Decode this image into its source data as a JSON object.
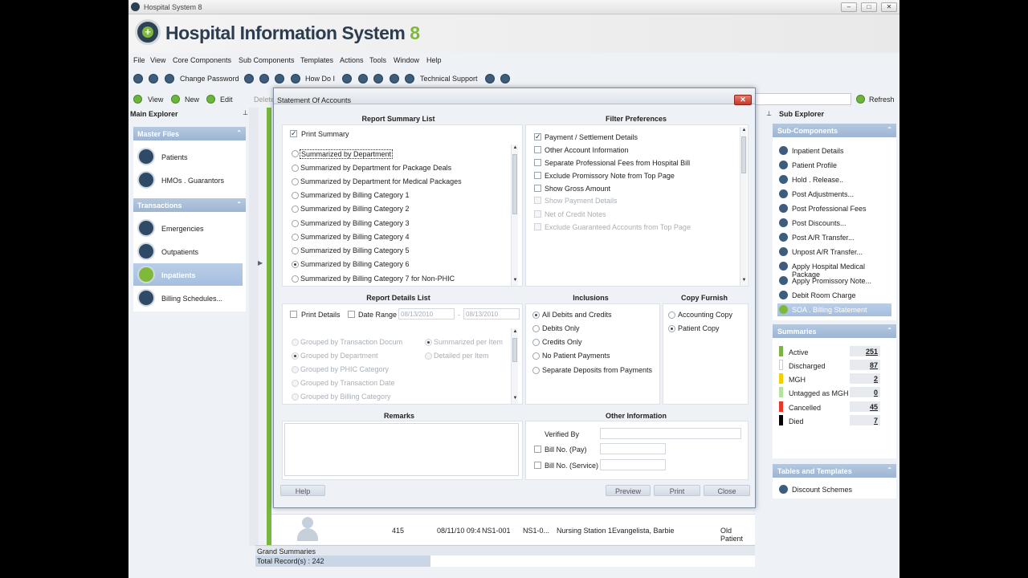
{
  "window": {
    "title": "Hospital System 8",
    "min": "–",
    "max": "□",
    "close": "✕"
  },
  "banner": {
    "title": "Hospital Information System",
    "version": "8"
  },
  "menu": [
    "File",
    "View",
    "Core Components",
    "Sub Components",
    "Templates",
    "Actions",
    "Tools",
    "Window",
    "Help"
  ],
  "toolbar1": {
    "change_password": "Change Password",
    "how_do_i": "How Do I",
    "technical_support": "Technical Support"
  },
  "toolbar2": {
    "view": "View",
    "new": "New",
    "edit": "Edit",
    "delete": "Delete",
    "refresh": "Refresh"
  },
  "left": {
    "header": "Main Explorer",
    "master_files": {
      "title": "Master Files",
      "items": [
        "Patients",
        "HMOs . Guarantors"
      ]
    },
    "transactions": {
      "title": "Transactions",
      "items": [
        "Emergencies",
        "Outpatients",
        "Inpatients",
        "Billing Schedules..."
      ]
    }
  },
  "grid_row": {
    "num": "415",
    "date": "08/11/10 09:4",
    "room": "NS1-001",
    "bed": "NS1-0...",
    "station": "Nursing Station 1",
    "name": "Evangelista, Barbie",
    "type": "Old Patient"
  },
  "bottom": {
    "grand": "Grand Summaries",
    "total": "Total Record(s) : 242"
  },
  "right": {
    "header": "Sub Explorer",
    "subcomponents": {
      "title": "Sub-Components",
      "items": [
        "Inpatient Details",
        "Patient Profile",
        "Hold . Release..",
        "Post Adjustments...",
        "Post Professional Fees",
        "Post Discounts...",
        "Post A/R Transfer...",
        "Unpost A/R Transfer...",
        "Apply Hospital Medical Package",
        "Apply Promissory Note...",
        "Debit Room Charge",
        "SOA . Billing Statement"
      ]
    },
    "summaries": {
      "title": "Summaries",
      "rows": [
        {
          "label": "Active",
          "value": "251",
          "color": "#7db244"
        },
        {
          "label": "Discharged",
          "value": "87",
          "color": "#ffffff"
        },
        {
          "label": "MGH",
          "value": "2",
          "color": "#f0d000"
        },
        {
          "label": "Untagged as MGH",
          "value": "0",
          "color": "#b8e0a0"
        },
        {
          "label": "Cancelled",
          "value": "45",
          "color": "#e8372a"
        },
        {
          "label": "Died",
          "value": "7",
          "color": "#000000"
        }
      ]
    },
    "tables": {
      "title": "Tables and Templates",
      "items": [
        "Discount Schemes"
      ]
    }
  },
  "dialog": {
    "title": "Statement Of Accounts",
    "close": "✕",
    "report_summary": {
      "title": "Report Summary List",
      "print_summary": "Print Summary",
      "options": [
        "Summarized by Department",
        "Summarized by Department for Package Deals",
        "Summarized by Department for Medical Packages",
        "Summarized by Billing Category 1",
        "Summarized by Billing Category 2",
        "Summarized by Billing Category 3",
        "Summarized by Billing Category 4",
        "Summarized by Billing Category 5",
        "Summarized by Billing Category 6",
        "Summarized by Billing Category 7 for Non-PHIC"
      ]
    },
    "filter": {
      "title": "Filter Preferences",
      "options": [
        "Payment / Settlement Details",
        "Other Account Information",
        "Separate Professional Fees from Hospital Bill",
        "Exclude Promissory Note from Top Page",
        "Show Gross Amount",
        "Show Payment Details",
        "Net of Credit Notes",
        "Exclude Guaranteed Accounts from Top Page"
      ]
    },
    "details": {
      "title": "Report Details List",
      "print_details": "Print Details",
      "date_range": "Date Range",
      "date_from": "08/13/2010",
      "date_sep": "-",
      "date_to": "08/13/2010",
      "group_options": [
        "Grouped by Transaction Docum",
        "Grouped by Department",
        "Grouped by PHIC Category",
        "Grouped by Transaction Date",
        "Grouped by Billing Category"
      ],
      "item_options": [
        "Summarized per Item",
        "Detailed per Item"
      ]
    },
    "inclusions": {
      "title": "Inclusions",
      "options": [
        "All Debits and Credits",
        "Debits Only",
        "Credits Only",
        "No Patient Payments",
        "Separate Deposits from Payments"
      ]
    },
    "copy": {
      "title": "Copy Furnish",
      "options": [
        "Accounting Copy",
        "Patient Copy"
      ]
    },
    "remarks": {
      "title": "Remarks"
    },
    "other": {
      "title": "Other Information",
      "verified_by": "Verified By",
      "bill_pay": "Bill No. (Pay)",
      "bill_service": "Bill No. (Service)"
    },
    "buttons": {
      "help": "Help",
      "preview": "Preview",
      "print": "Print",
      "close": "Close"
    }
  }
}
